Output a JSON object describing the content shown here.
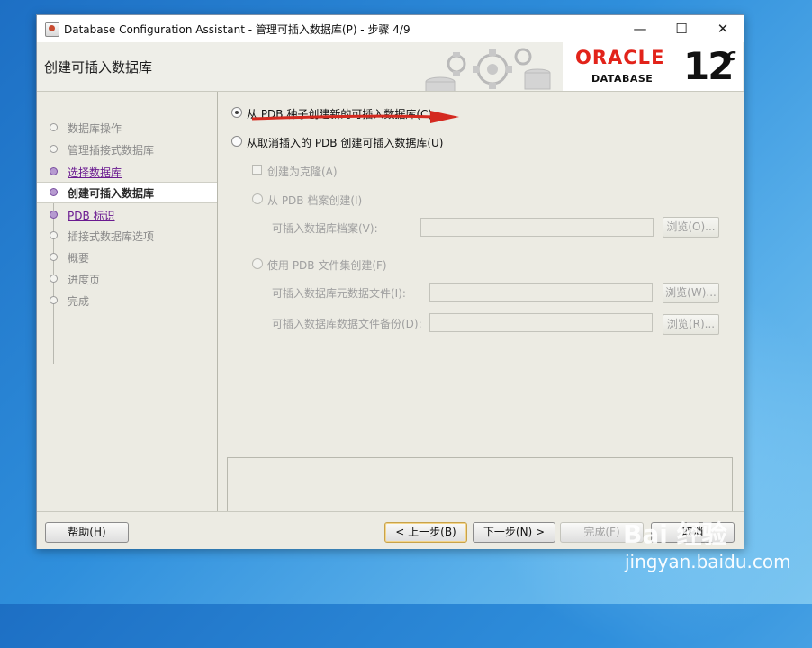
{
  "window": {
    "title": "Database Configuration Assistant - 管理可插入数据库(P) - 步骤 4/9",
    "controls": {
      "minimize": "—",
      "maximize": "☐",
      "close": "✕"
    }
  },
  "header": {
    "page_title": "创建可插入数据库",
    "logo": {
      "brand": "ORACLE",
      "product": "DATABASE",
      "version": "12",
      "version_sup": "c"
    }
  },
  "steps": [
    {
      "label": "数据库操作",
      "state": "done"
    },
    {
      "label": "管理插接式数据库",
      "state": "done"
    },
    {
      "label": "选择数据库",
      "state": "link"
    },
    {
      "label": "创建可插入数据库",
      "state": "current"
    },
    {
      "label": "PDB 标识",
      "state": "link"
    },
    {
      "label": "插接式数据库选项",
      "state": "pending"
    },
    {
      "label": "概要",
      "state": "pending"
    },
    {
      "label": "进度页",
      "state": "pending"
    },
    {
      "label": "完成",
      "state": "pending"
    }
  ],
  "options": {
    "from_seed": {
      "label": "从 PDB 种子创建新的可插入数据库(C)",
      "checked": true
    },
    "from_unplugged": {
      "label": "从取消插入的 PDB 创建可插入数据库(U)",
      "checked": false
    },
    "create_as_clone": {
      "label": "创建为克隆(A)",
      "checked": false
    },
    "from_archive": {
      "label": "从 PDB 档案创建(I)"
    },
    "archive_field_label": "可插入数据库档案(V):",
    "archive_value": "",
    "use_fileset": {
      "label": "使用 PDB 文件集创建(F)"
    },
    "metadata_field_label": "可插入数据库元数据文件(I):",
    "metadata_value": "",
    "backup_field_label": "可插入数据库数据文件备份(D):",
    "backup_value": "",
    "browse_o": "浏览(O)...",
    "browse_w": "浏览(W)...",
    "browse_r": "浏览(R)..."
  },
  "buttons": {
    "help": "帮助(H)",
    "back": "< 上一步(B)",
    "next": "下一步(N) >",
    "finish": "完成(F)",
    "cancel": "取消"
  },
  "watermark": {
    "logo": "Bai  经验",
    "url": "jingyan.baidu.com"
  }
}
